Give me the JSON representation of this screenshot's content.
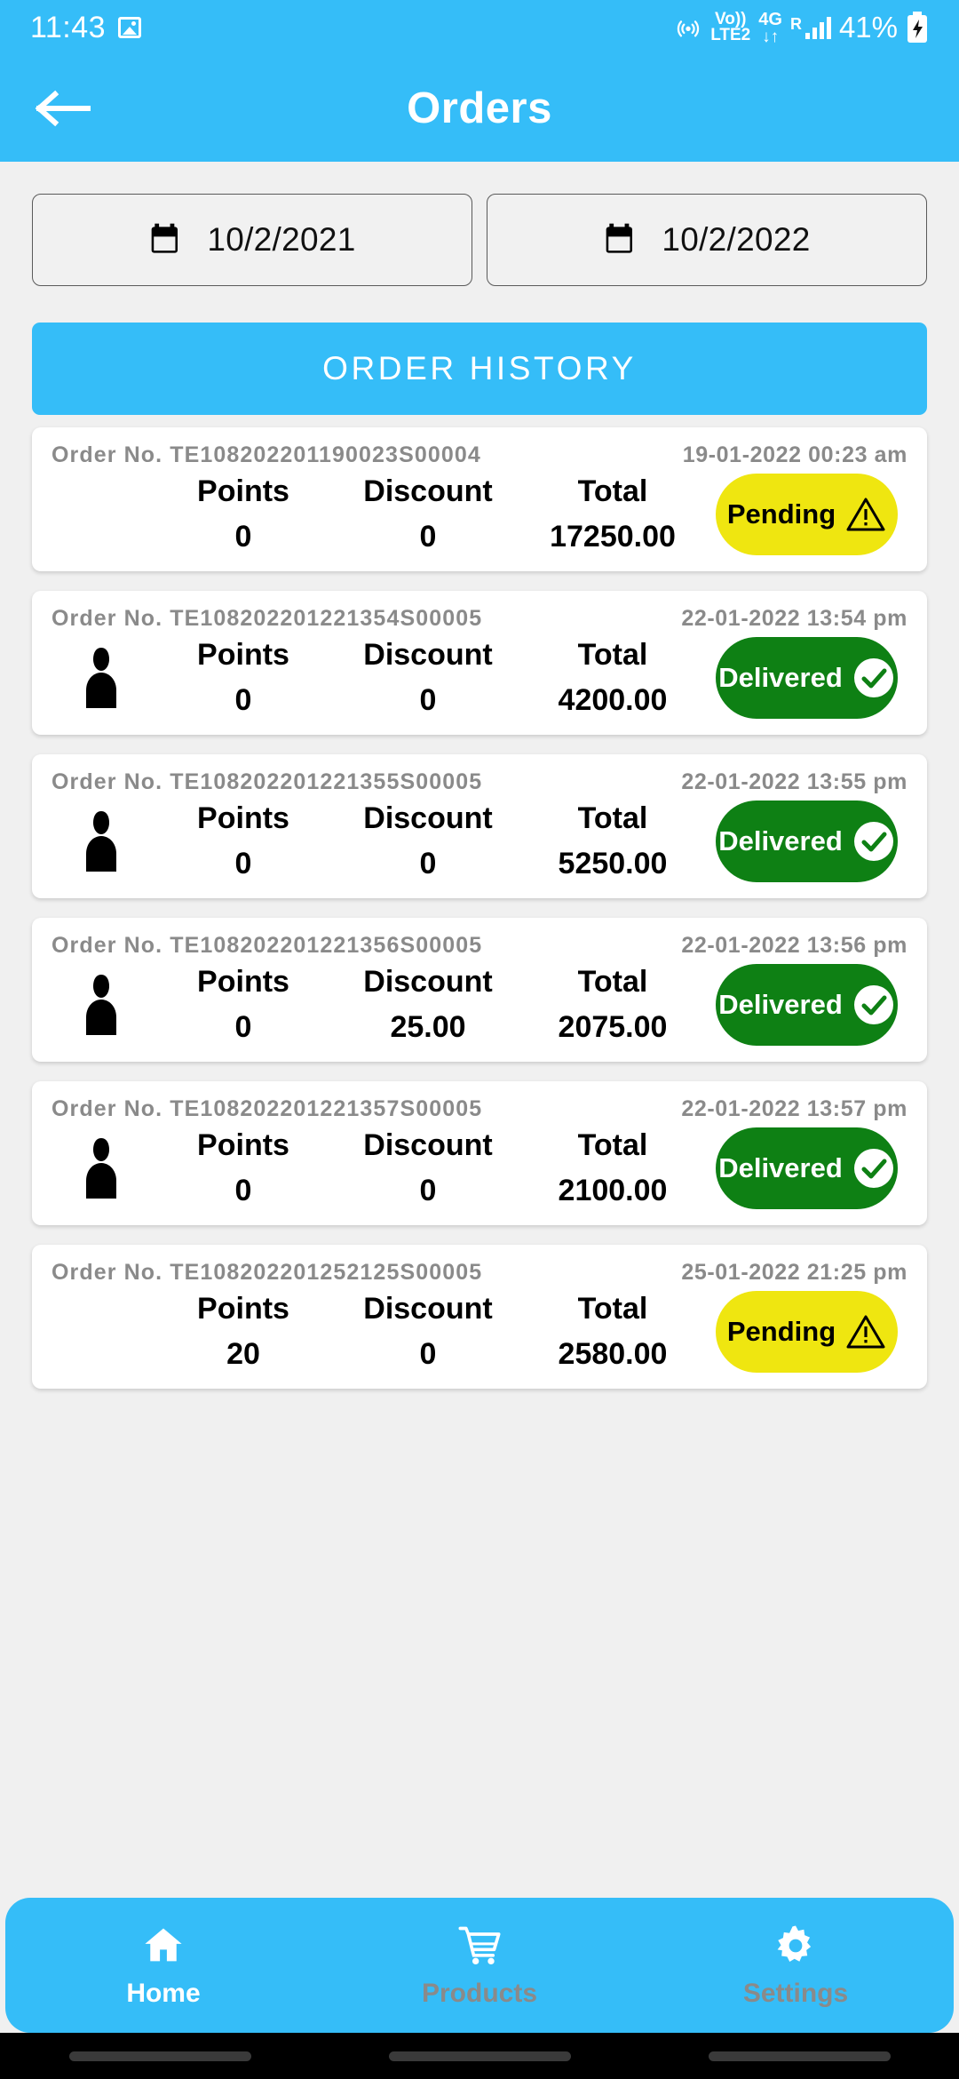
{
  "status_bar": {
    "time": "11:43",
    "image_icon": "image-icon",
    "volte_label": "Vo))",
    "lte_label": "LTE2",
    "network_4g": "4G",
    "roaming": "R",
    "battery_percent": "41%",
    "battery_icon": "battery-charging-icon"
  },
  "app_bar": {
    "back_icon": "back-arrow-icon",
    "title": "Orders"
  },
  "filters": {
    "from_date": "10/2/2021",
    "to_date": "10/2/2022",
    "calendar_icon": "calendar-icon"
  },
  "history_button": {
    "label": "ORDER HISTORY"
  },
  "order_columns": {
    "points": "Points",
    "discount": "Discount",
    "total": "Total"
  },
  "labels": {
    "order_prefix": "Order No.",
    "status_pending": "Pending",
    "status_delivered": "Delivered"
  },
  "orders": [
    {
      "order_no": "Order No. TE108202201190023S00004",
      "timestamp": "19-01-2022 00:23 am",
      "points": "0",
      "discount": "0",
      "total": "17250.00",
      "status": "Pending",
      "status_type": "pending",
      "has_person_icon": false
    },
    {
      "order_no": "Order No. TE108202201221354S00005",
      "timestamp": "22-01-2022 13:54 pm",
      "points": "0",
      "discount": "0",
      "total": "4200.00",
      "status": "Delivered",
      "status_type": "delivered",
      "has_person_icon": true
    },
    {
      "order_no": "Order No. TE108202201221355S00005",
      "timestamp": "22-01-2022 13:55 pm",
      "points": "0",
      "discount": "0",
      "total": "5250.00",
      "status": "Delivered",
      "status_type": "delivered",
      "has_person_icon": true
    },
    {
      "order_no": "Order No. TE108202201221356S00005",
      "timestamp": "22-01-2022 13:56 pm",
      "points": "0",
      "discount": "25.00",
      "total": "2075.00",
      "status": "Delivered",
      "status_type": "delivered",
      "has_person_icon": true
    },
    {
      "order_no": "Order No. TE108202201221357S00005",
      "timestamp": "22-01-2022 13:57 pm",
      "points": "0",
      "discount": "0",
      "total": "2100.00",
      "status": "Delivered",
      "status_type": "delivered",
      "has_person_icon": true
    },
    {
      "order_no": "Order No. TE108202201252125S00005",
      "timestamp": "25-01-2022 21:25 pm",
      "points": "20",
      "discount": "0",
      "total": "2580.00",
      "status": "Pending",
      "status_type": "pending",
      "has_person_icon": false
    }
  ],
  "bottom_nav": [
    {
      "label": "Home",
      "icon": "home-icon",
      "active": true
    },
    {
      "label": "Products",
      "icon": "cart-icon",
      "active": false
    },
    {
      "label": "Settings",
      "icon": "gear-icon",
      "active": false
    }
  ],
  "colors": {
    "brand_blue": "#35bdf8",
    "pending_yellow": "#efe610",
    "delivered_green": "#0e8014",
    "page_bg": "#f0f0f0"
  }
}
